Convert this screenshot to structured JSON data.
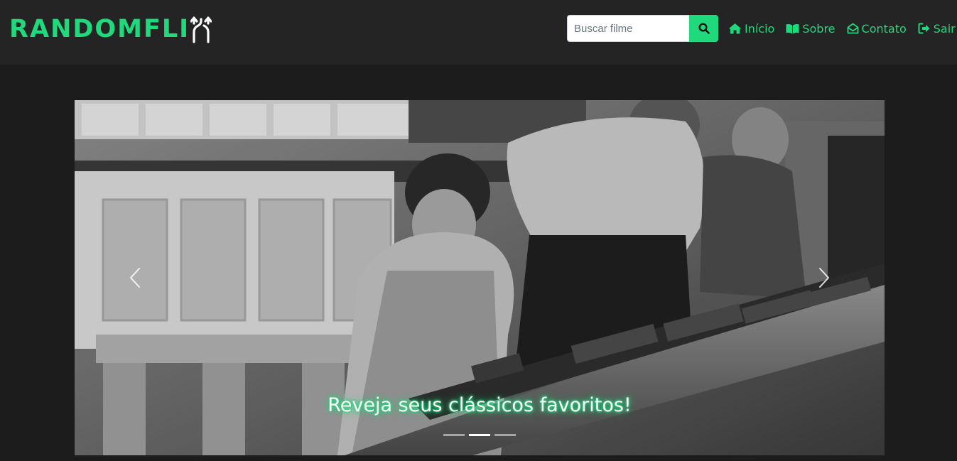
{
  "brand": {
    "name": "RANDOMFLI",
    "accent": "#1fd97c"
  },
  "search": {
    "placeholder": "Buscar filme",
    "value": "",
    "icon": "search-icon"
  },
  "nav": {
    "items": [
      {
        "label": "Início",
        "icon": "home-icon"
      },
      {
        "label": "Sobre",
        "icon": "book-open-icon"
      },
      {
        "label": "Contato",
        "icon": "envelope-open-icon"
      },
      {
        "label": "Sair",
        "icon": "sign-out-icon"
      }
    ]
  },
  "carousel": {
    "caption": "Reveja seus clássicos favoritos!",
    "slide_count": 3,
    "active_index": 1
  },
  "colors": {
    "navbar": "#242424",
    "page": "#1c1c1c",
    "accent": "#1fd97c"
  }
}
